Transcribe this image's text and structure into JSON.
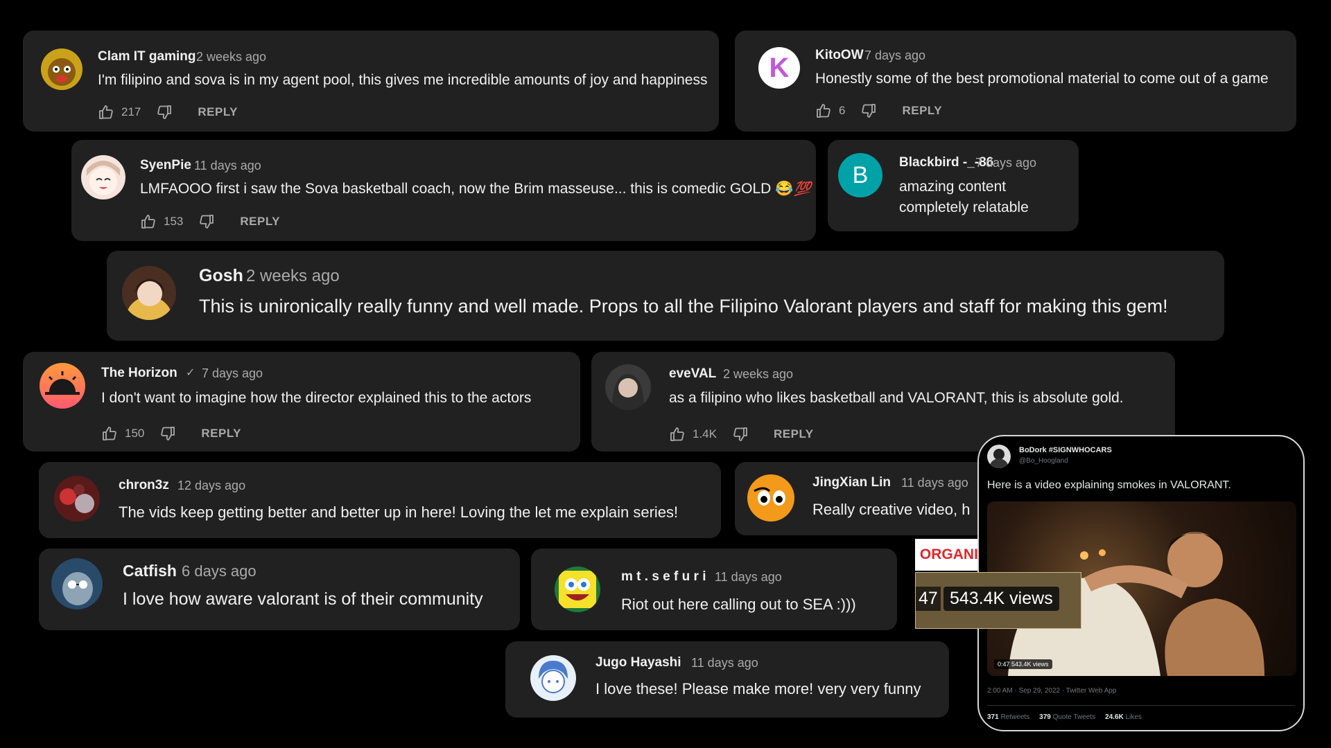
{
  "comments": [
    {
      "name": "Clam IT gaming",
      "time": "2 weeks ago",
      "text": "I'm filipino and sova is in my agent pool, this gives me incredible amounts of joy and happiness",
      "likes": "217",
      "reply": "REPLY"
    },
    {
      "name": "KitoOW",
      "time": "7 days ago",
      "text": "Honestly some of the best promotional material to come out of a game",
      "likes": "6",
      "reply": "REPLY",
      "avatar_letter": "K"
    },
    {
      "name": "SyenPie",
      "time": "11 days ago",
      "text": "LMFAOOO first i saw the Sova basketball coach, now the Brim masseuse... this is comedic GOLD 😂",
      "emoji": "💯",
      "likes": "153",
      "reply": "REPLY"
    },
    {
      "name": "Blackbird -_-86",
      "time": "7 days ago",
      "text_line1": "amazing content",
      "text_line2": "completely relatable",
      "avatar_letter": "B"
    },
    {
      "name": "Gosh",
      "time": "2 weeks ago",
      "text": "This is unironically really funny and well made. Props to all the Filipino Valorant players and staff for making this gem!"
    },
    {
      "name": "The Horizon",
      "verified": "✓",
      "time": "7 days ago",
      "text": "I don't want to imagine how the director explained this to the actors",
      "likes": "150",
      "reply": "REPLY"
    },
    {
      "name": "eveVAL",
      "time": "2 weeks ago",
      "text": "as a filipino who likes basketball and VALORANT, this is absolute gold.",
      "likes": "1.4K",
      "reply": "REPLY"
    },
    {
      "name": "chron3z",
      "time": "12 days ago",
      "text": "The vids keep getting better and better up in here! Loving the let me explain series!"
    },
    {
      "name": "JingXian Lin",
      "time": "11 days ago",
      "text": "Really creative video, h"
    },
    {
      "name": "Catfish",
      "time": "6 days ago",
      "text": "I love how aware valorant is of their community"
    },
    {
      "name": "m t . s e f u r i",
      "time": "11 days ago",
      "text": "Riot out here calling out to SEA :)))"
    },
    {
      "name": "Jugo Hayashi",
      "time": "11 days ago",
      "text": "I love these! Please make more! very very funny"
    }
  ],
  "tweet": {
    "display_name": "BoDork #SIGNWHOCARS",
    "handle": "@Bo_Hoogland",
    "text": "Here is a video explaining smokes in VALORANT.",
    "video_badge": "0:47 543.4K views",
    "timestamp": "2:00 AM · Sep 29, 2022 · Twitter Web App",
    "retweets_count": "371",
    "retweets_label": "Retweets",
    "quotes_count": "379",
    "quotes_label": "Quote Tweets",
    "likes_count": "24.6K",
    "likes_label": "Likes"
  },
  "overlay": {
    "organic": "ORGANIC!!!",
    "views_prefix": "47",
    "views": "543.4K views"
  },
  "colors": {
    "background": "#000000",
    "card": "#212121",
    "text": "#f1f1f1",
    "secondary": "#aaaaaa",
    "kito_avatar": "#ffffff",
    "kito_letter": "#c158dc",
    "blackbird_avatar": "#00a2a8",
    "organic_red": "#e0262b"
  }
}
